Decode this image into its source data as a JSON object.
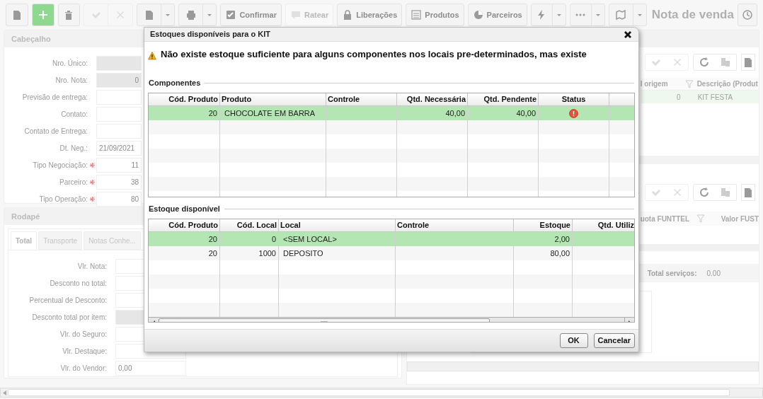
{
  "toolbar": {
    "buttons": [
      {
        "label": "Confirmar",
        "disabled": false
      },
      {
        "label": "Ratear",
        "disabled": true
      },
      {
        "label": "Liberações",
        "disabled": false
      },
      {
        "label": "Produtos",
        "disabled": false
      },
      {
        "label": "Parceiros",
        "disabled": false
      }
    ],
    "title": "Nota de venda"
  },
  "header_panel": {
    "title": "Cabeçalho",
    "fields": [
      {
        "label": "Nro. Único:",
        "readonly": true,
        "required": false
      },
      {
        "label": "Nro. Nota:",
        "value": "0",
        "readonly": true,
        "required": false
      },
      {
        "label": "Previsão de entrega:",
        "readonly": false,
        "required": false
      },
      {
        "label": "Contato:",
        "readonly": false,
        "required": false
      },
      {
        "label": "Contato de Entrega:",
        "readonly": false,
        "required": false
      },
      {
        "label": "Dt. Neg.:",
        "value": "21/09/2021",
        "readonly": false,
        "required": false
      },
      {
        "label": "Tipo Negociação:",
        "value": "11",
        "readonly": false,
        "required": true
      },
      {
        "label": "Parceiro:",
        "value": "38",
        "readonly": false,
        "required": true
      },
      {
        "label": "Tipo Operação:",
        "value": "80",
        "readonly": false,
        "required": true
      }
    ]
  },
  "footer_panel": {
    "title": "Rodapé",
    "tabs": [
      {
        "label": "Total",
        "selected": true
      },
      {
        "label": "Transporte",
        "selected": false
      },
      {
        "label": "Notas Conhe...",
        "selected": false
      }
    ],
    "fields": [
      {
        "label": "Vlr. Nota:",
        "readonly": false
      },
      {
        "label": "Desconto no total:",
        "readonly": false
      },
      {
        "label": "Percentual de Desconto:",
        "readonly": false
      },
      {
        "label": "Desconto total por item:",
        "readonly": true
      },
      {
        "label": "Vlr. do Seguro:",
        "readonly": false
      },
      {
        "label": "Vlr. Destaque:",
        "readonly": false
      },
      {
        "label": "Vlr. do Vendor:",
        "value": "0,00",
        "readonly": false
      }
    ]
  },
  "items_grid": {
    "columns": [
      "l origem",
      "Descrição (Produt"
    ],
    "rows": [
      {
        "cells": [
          "0",
          "KIT FESTA"
        ],
        "selected": true
      }
    ]
  },
  "taxes_grid": {
    "columns": [
      "uota FUNTTEL",
      "Valor FUST"
    ]
  },
  "totals": {
    "label": "Total serviços:",
    "value": "0.00"
  },
  "dialog": {
    "title": "Estoques disponíveis para o KIT",
    "message": "Não existe estoque suficiente para alguns componentes nos locais pre-determinados, mas existe",
    "components": {
      "legend": "Componentes",
      "columns": [
        "Cód. Produto",
        "Produto",
        "Controle",
        "Qtd. Necessária",
        "Qtd. Pendente",
        "Status"
      ],
      "rows": [
        {
          "cells": [
            "20",
            "CHOCOLATE EM BARRA",
            "",
            "40,00",
            "40,00"
          ],
          "error": true,
          "selected": true
        }
      ]
    },
    "stock": {
      "legend": "Estoque disponível",
      "columns": [
        "Cód. Produto",
        "Cód. Local",
        "Local",
        "Controle",
        "Estoque",
        "Qtd. Utiliz"
      ],
      "rows": [
        {
          "cells": [
            "20",
            "0",
            "<SEM LOCAL>",
            "",
            "2,00",
            ""
          ],
          "selected": true
        },
        {
          "cells": [
            "20",
            "1000",
            "DEPOSITO",
            "",
            "80,00",
            ""
          ],
          "selected": false
        }
      ]
    },
    "buttons": [
      "OK",
      "Cancelar"
    ]
  }
}
